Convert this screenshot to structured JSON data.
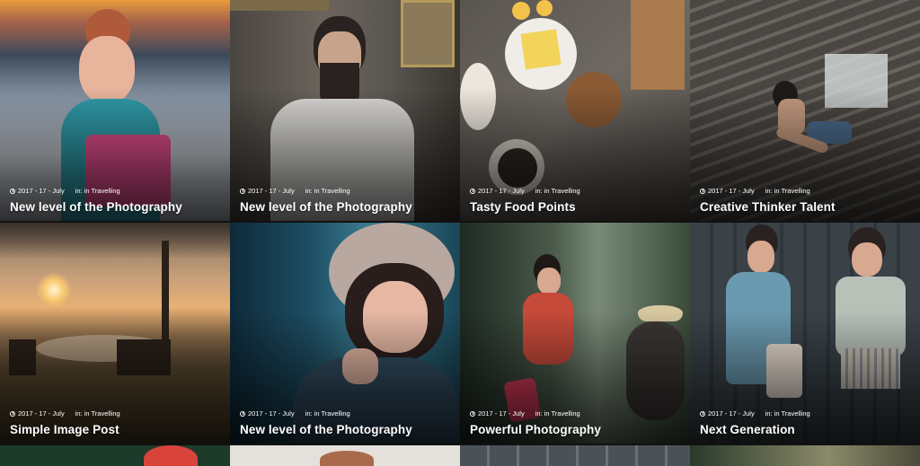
{
  "posts": [
    {
      "date": "2017 - 17 - July",
      "category": "in: in Travelling",
      "title": "New level of the Photography",
      "image": "child-portrait-sunset"
    },
    {
      "date": "2017 - 17 - July",
      "category": "in: in Travelling",
      "title": "New level of the Photography",
      "image": "bearded-man-portrait"
    },
    {
      "date": "2017 - 17 - July",
      "category": "in: in Travelling",
      "title": "Tasty Food Points",
      "image": "food-ingredients-table"
    },
    {
      "date": "2017 - 17 - July",
      "category": "in: in Travelling",
      "title": "Creative Thinker Talent",
      "image": "woman-sitting-stairs"
    },
    {
      "date": "2017 - 17 - July",
      "category": "in: in Travelling",
      "title": "Simple Image Post",
      "image": "park-sunset-trees"
    },
    {
      "date": "2017 - 17 - July",
      "category": "in: in Travelling",
      "title": "New level of the Photography",
      "image": "woman-winter-hood"
    },
    {
      "date": "2017 - 17 - July",
      "category": "in: in Travelling",
      "title": "Powerful Photography",
      "image": "woman-forest-rock"
    },
    {
      "date": "2017 - 17 - July",
      "category": "in: in Travelling",
      "title": "Next Generation",
      "image": "two-children-holding-hands"
    }
  ],
  "colors": {
    "text": "#ffffff",
    "background": "#111111"
  }
}
